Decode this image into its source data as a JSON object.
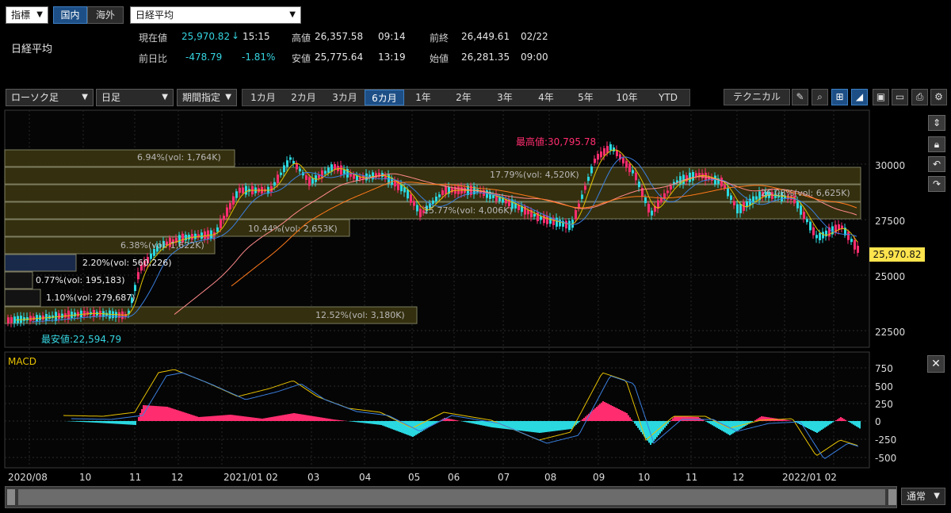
{
  "header": {
    "type_select": "指標",
    "tab_domestic": "国内",
    "tab_overseas": "海外",
    "symbol_select": "日経平均",
    "symbol_name": "日経平均"
  },
  "quote": {
    "current_label": "現在値",
    "current_value": "25,970.82",
    "current_arrow": "↓",
    "current_time": "15:15",
    "high_label": "高値",
    "high_value": "26,357.58",
    "high_time": "09:14",
    "prev_close_label": "前終",
    "prev_close_value": "26,449.61",
    "prev_close_date": "02/22",
    "change_label": "前日比",
    "change_value": "-478.79",
    "change_pct": "-1.81%",
    "low_label": "安値",
    "low_value": "25,775.64",
    "low_time": "13:19",
    "open_label": "始値",
    "open_value": "26,281.35",
    "open_time": "09:00"
  },
  "toolbar": {
    "chart_type": "ローソク足",
    "interval": "日足",
    "range_mode": "期間指定",
    "periods": [
      "1カ月",
      "2カ月",
      "3カ月",
      "6カ月",
      "1年",
      "2年",
      "3年",
      "4年",
      "5年",
      "10年",
      "YTD"
    ],
    "active_period": "6カ月",
    "technical": "テクニカル"
  },
  "price_axis": [
    "30000",
    "27500",
    "25000",
    "22500"
  ],
  "last_price_tag": "25,970.82",
  "annotations": {
    "high": "最高値:30,795.78",
    "low": "最安値:22,594.79"
  },
  "volume_profile": [
    {
      "text": "6.94%(vol: 1,764K)"
    },
    {
      "text": "17.79%(vol: 4,520K)"
    },
    {
      "text": "26.08%(vol: 6,625K)"
    },
    {
      "text": "15.77%(vol: 4,006K)"
    },
    {
      "text": "10.44%(vol: 2,653K)"
    },
    {
      "text": "6.38%(vol: 1,622K)"
    },
    {
      "text": "2.20%(vol: 560,226)"
    },
    {
      "text": "0.77%(vol: 195,183)"
    },
    {
      "text": "1.10%(vol: 279,687)"
    },
    {
      "text": "12.52%(vol: 3,180K)"
    }
  ],
  "macd": {
    "label": "MACD",
    "axis": [
      "750",
      "500",
      "250",
      "0",
      "-250",
      "-500"
    ]
  },
  "time_axis": [
    "2020/08",
    "10",
    "11",
    "12",
    "2021/01 02",
    "03",
    "04",
    "05",
    "06",
    "07",
    "08",
    "09",
    "10",
    "11",
    "12",
    "2022/01 02"
  ],
  "footer": {
    "mode_select": "通常"
  },
  "colors": {
    "up": "#ff2d6f",
    "down": "#2ad8e0",
    "macd_line": "#e6c100",
    "signal_line": "#3a7fe0",
    "ma_short": "#e0c000",
    "ma_mid": "#3a7fe0",
    "ma_long1": "#ff8a8a",
    "ma_long2": "#ff7a1a"
  }
}
